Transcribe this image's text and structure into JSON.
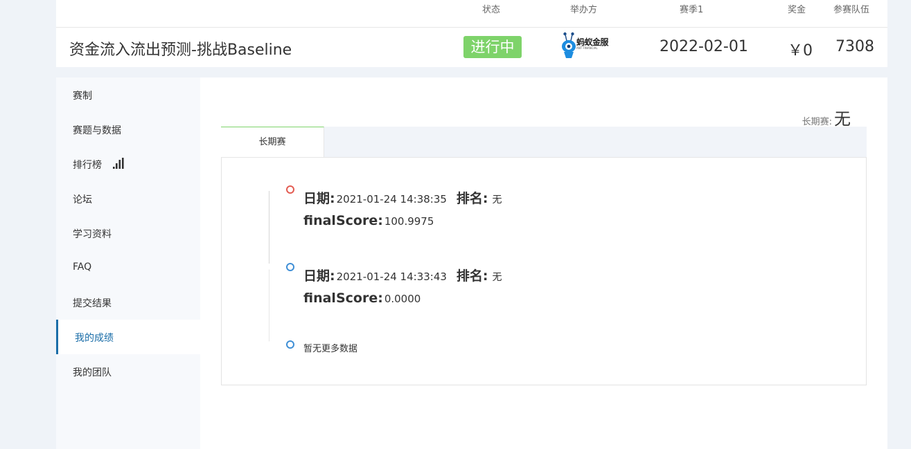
{
  "header": {
    "columns": [
      "状态",
      "举办方",
      "赛季1",
      "奖金",
      "参赛队伍"
    ],
    "title": "资金流入流出预测-挑战Baseline",
    "status": "进行中",
    "organizer_logo": {
      "name": "蚂蚁金服",
      "sub": "ANT FINANCIAL",
      "icon": "ant-financial-logo"
    },
    "season_date": "2022-02-01",
    "prize": "￥0",
    "teams": "7308",
    "status_color": "#7ed36a"
  },
  "sidebar": {
    "items": [
      {
        "label": "赛制"
      },
      {
        "label": "赛题与数据"
      },
      {
        "label": "排行榜",
        "icon": "bar-chart-icon"
      },
      {
        "label": "论坛"
      },
      {
        "label": "学习资料"
      },
      {
        "label": "FAQ"
      },
      {
        "label": "提交结果"
      },
      {
        "label": "我的成绩",
        "active": true
      },
      {
        "label": "我的团队"
      }
    ],
    "active_color": "#1a6da8"
  },
  "main": {
    "long_term_label": "长期赛:",
    "long_term_value": "无",
    "tab": "长期赛",
    "entries": [
      {
        "date_label": "日期:",
        "date": "2021-01-24 14:38:35",
        "rank_label": "排名:",
        "rank": "无",
        "score_label": "finalScore:",
        "score": "100.9975",
        "dot_color": "#e35c52"
      },
      {
        "date_label": "日期:",
        "date": "2021-01-24 14:33:43",
        "rank_label": "排名:",
        "rank": "无",
        "score_label": "finalScore:",
        "score": "0.0000",
        "dot_color": "#3f8fd6"
      }
    ],
    "no_more": "暂无更多数据"
  }
}
